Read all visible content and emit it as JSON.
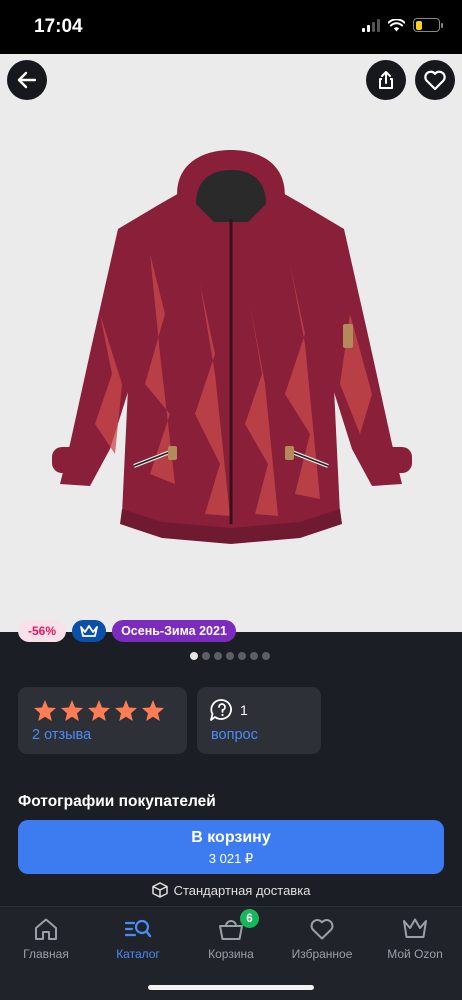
{
  "status_bar": {
    "time": "17:04",
    "battery_level": 0.3
  },
  "product": {
    "image_icon": "jacket-photo",
    "jacket_color": "#8a1f3a",
    "pattern_color": "#c94a4a"
  },
  "tags": {
    "discount": "-56%",
    "premium_icon": "crown-icon",
    "season": "Осень-Зима 2021"
  },
  "gallery": {
    "total": 7,
    "active_index": 0
  },
  "rating": {
    "stars": 5,
    "max_stars": 5,
    "reviews_label": "2 отзыва",
    "star_color": "#ff7d54"
  },
  "questions": {
    "count": "1",
    "label": "вопрос"
  },
  "customer_photos_title": "Фотографии покупателей",
  "cart_button": {
    "label": "В корзину",
    "price": "3 021 ₽",
    "color": "#3d7cf0"
  },
  "delivery_text": "Стандартная доставка",
  "tabbar": {
    "items": [
      {
        "label": "Главная",
        "icon": "home-icon",
        "active": false
      },
      {
        "label": "Каталог",
        "icon": "catalog-search-icon",
        "active": true
      },
      {
        "label": "Корзина",
        "icon": "cart-icon",
        "active": false,
        "badge": "6"
      },
      {
        "label": "Избранное",
        "icon": "heart-icon",
        "active": false
      },
      {
        "label": "Мой Ozon",
        "icon": "crown-icon",
        "active": false
      }
    ]
  }
}
